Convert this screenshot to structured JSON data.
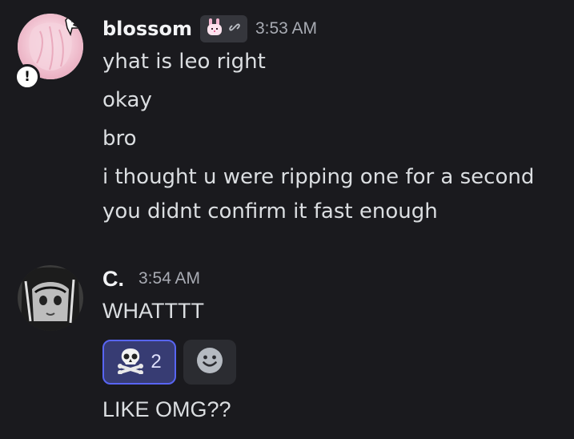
{
  "messages": [
    {
      "author": "blossom",
      "timestamp": "3:53 AM",
      "tag_icons": [
        "bunny-icon",
        "link-icon"
      ],
      "avatar_badge": "!",
      "lines": [
        "yhat is leo right",
        "okay",
        "bro",
        "i thought u were ripping one for a second",
        "you didnt confirm it fast enough"
      ]
    },
    {
      "author": "C.",
      "timestamp": "3:54 AM",
      "lines": [
        "WHATTTT",
        "LIKE OMG??"
      ],
      "reactions": [
        {
          "emoji": "skull-and-crossbones-icon",
          "count": "2",
          "active": true
        }
      ]
    }
  ],
  "colors": {
    "background": "#1a1a1e",
    "author_text": "#f2f3f5",
    "message_text": "#dbdee1",
    "timestamp_text": "#a8abb3",
    "reaction_active_border": "#5865f2",
    "reaction_active_bg": "#373c73",
    "add_reaction_bg": "#2b2c31"
  }
}
